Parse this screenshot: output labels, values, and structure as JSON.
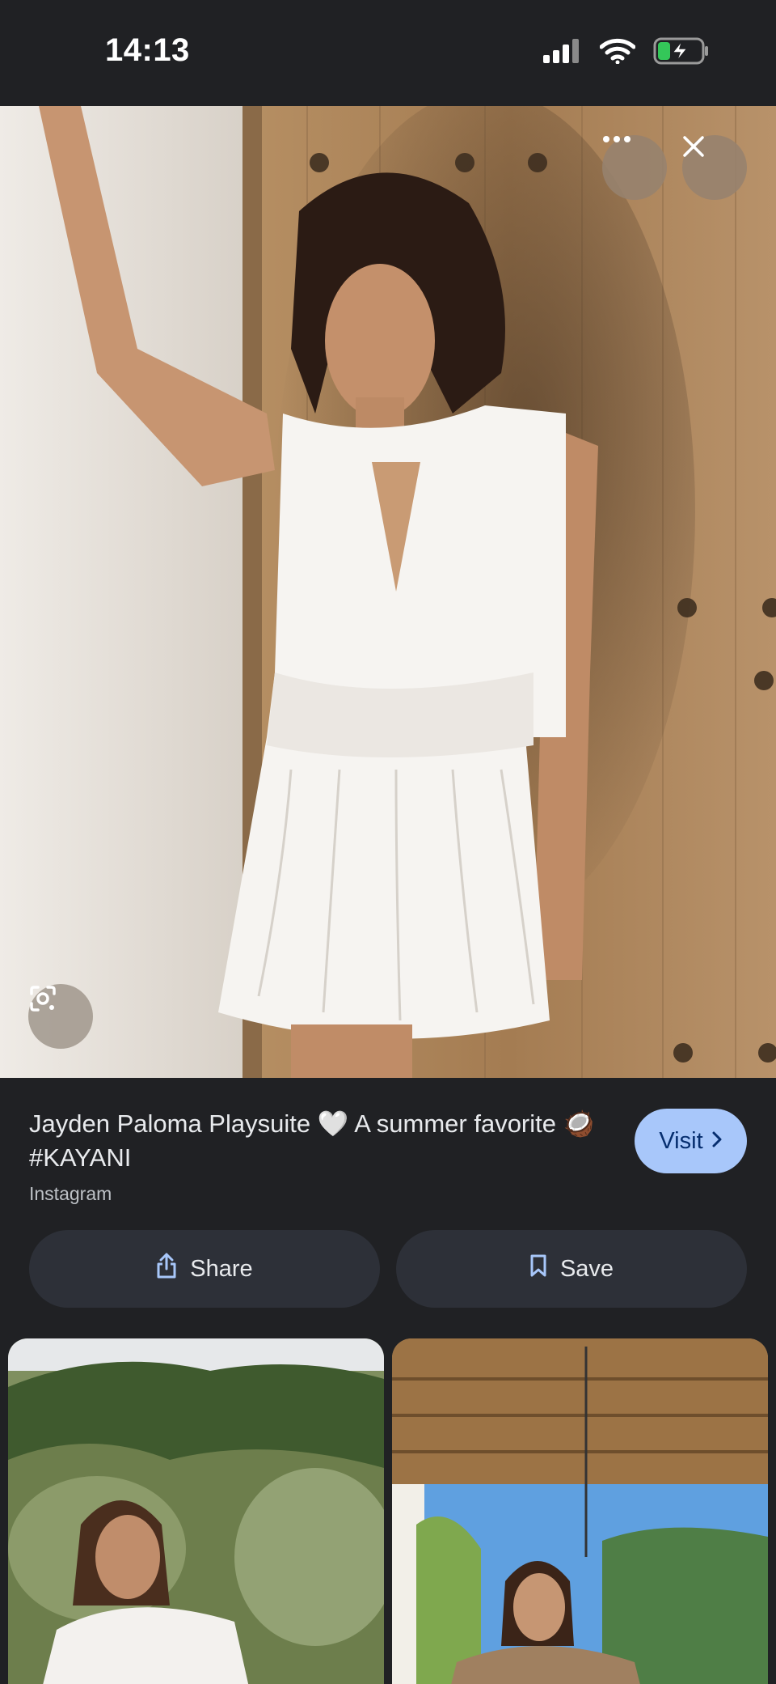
{
  "status": {
    "time": "14:13",
    "icons": [
      "signal-icon",
      "wifi-icon",
      "battery-charging-icon"
    ]
  },
  "hero": {
    "icons": [
      "more-icon",
      "close-icon",
      "lens-icon"
    ]
  },
  "result": {
    "title": "Jayden Paloma Playsuite 🤍 A summer favorite 🥥 #KAYANI",
    "source": "Instagram",
    "visit_label": "Visit",
    "share_label": "Share",
    "save_label": "Save"
  },
  "colors": {
    "background": "#202124",
    "accent": "#a8c7fa",
    "button_bg": "#2d3038",
    "icon_accent": "#a8c7fa"
  }
}
